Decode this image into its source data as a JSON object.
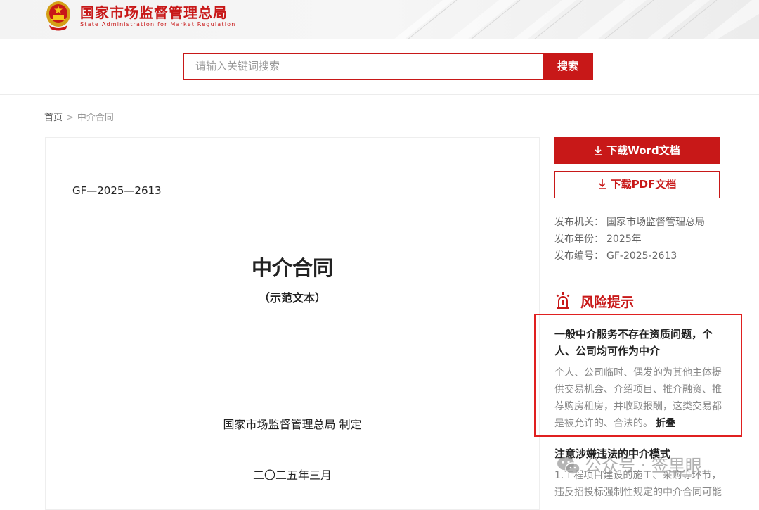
{
  "header": {
    "site_title": "国家市场监督管理总局",
    "site_subtitle": "State Administration for Market Regulation",
    "brand_color": "#c81818"
  },
  "search": {
    "placeholder": "请输入关键词搜索",
    "button_label": "搜索"
  },
  "breadcrumb": {
    "home": "首页",
    "separator": ">",
    "current": "中介合同"
  },
  "document": {
    "code": "GF—2025—2613",
    "title": "中介合同",
    "subtitle": "（示范文本）",
    "issuer": "国家市场监督管理总局 制定",
    "date": "二〇二五年三月"
  },
  "downloads": {
    "word_label": "下载Word文档",
    "pdf_label": "下载PDF文档"
  },
  "meta": {
    "agency_label": "发布机关：",
    "agency_value": "国家市场监督管理总局",
    "year_label": "发布年份：",
    "year_value": "2025年",
    "number_label": "发布编号：",
    "number_value": "GF-2025-2613"
  },
  "risk": {
    "title": "风险提示",
    "items": [
      {
        "title": "一般中介服务不存在资质问题，个人、公司均可作为中介",
        "body": "个人、公司临时、偶发的为其他主体提供交易机会、介绍项目、推介融资、推荐购房租房，并收取报酬，这类交易都是被允许的、合法的。",
        "fold_label": "折叠"
      },
      {
        "title": "注意涉嫌违法的中介模式",
        "body": "1.工程项目建设的施工、采购等环节，违反招投标强制性规定的中介合同可能"
      }
    ]
  },
  "watermark": {
    "text": "公众号 · 签里眼"
  }
}
